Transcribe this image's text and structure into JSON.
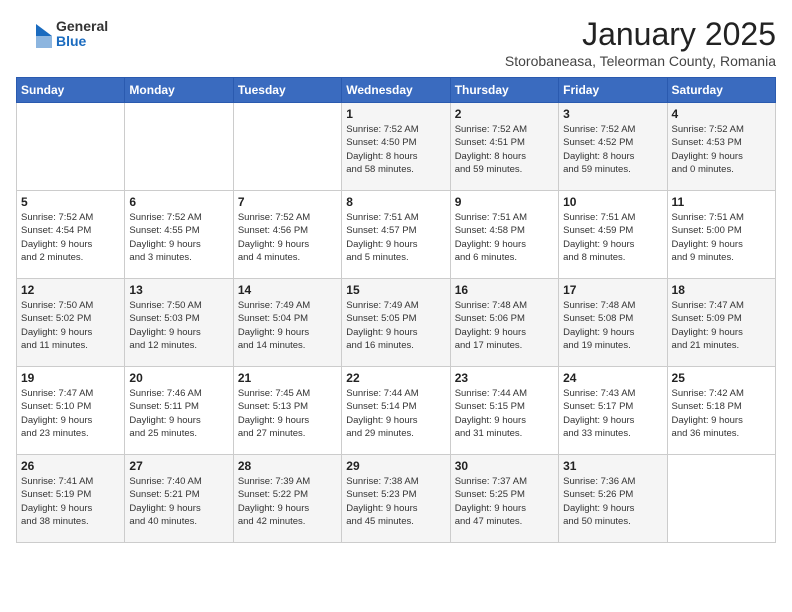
{
  "logo": {
    "general": "General",
    "blue": "Blue"
  },
  "title": "January 2025",
  "location": "Storobaneasa, Teleorman County, Romania",
  "weekdays": [
    "Sunday",
    "Monday",
    "Tuesday",
    "Wednesday",
    "Thursday",
    "Friday",
    "Saturday"
  ],
  "weeks": [
    [
      {
        "day": "",
        "info": ""
      },
      {
        "day": "",
        "info": ""
      },
      {
        "day": "",
        "info": ""
      },
      {
        "day": "1",
        "info": "Sunrise: 7:52 AM\nSunset: 4:50 PM\nDaylight: 8 hours\nand 58 minutes."
      },
      {
        "day": "2",
        "info": "Sunrise: 7:52 AM\nSunset: 4:51 PM\nDaylight: 8 hours\nand 59 minutes."
      },
      {
        "day": "3",
        "info": "Sunrise: 7:52 AM\nSunset: 4:52 PM\nDaylight: 8 hours\nand 59 minutes."
      },
      {
        "day": "4",
        "info": "Sunrise: 7:52 AM\nSunset: 4:53 PM\nDaylight: 9 hours\nand 0 minutes."
      }
    ],
    [
      {
        "day": "5",
        "info": "Sunrise: 7:52 AM\nSunset: 4:54 PM\nDaylight: 9 hours\nand 2 minutes."
      },
      {
        "day": "6",
        "info": "Sunrise: 7:52 AM\nSunset: 4:55 PM\nDaylight: 9 hours\nand 3 minutes."
      },
      {
        "day": "7",
        "info": "Sunrise: 7:52 AM\nSunset: 4:56 PM\nDaylight: 9 hours\nand 4 minutes."
      },
      {
        "day": "8",
        "info": "Sunrise: 7:51 AM\nSunset: 4:57 PM\nDaylight: 9 hours\nand 5 minutes."
      },
      {
        "day": "9",
        "info": "Sunrise: 7:51 AM\nSunset: 4:58 PM\nDaylight: 9 hours\nand 6 minutes."
      },
      {
        "day": "10",
        "info": "Sunrise: 7:51 AM\nSunset: 4:59 PM\nDaylight: 9 hours\nand 8 minutes."
      },
      {
        "day": "11",
        "info": "Sunrise: 7:51 AM\nSunset: 5:00 PM\nDaylight: 9 hours\nand 9 minutes."
      }
    ],
    [
      {
        "day": "12",
        "info": "Sunrise: 7:50 AM\nSunset: 5:02 PM\nDaylight: 9 hours\nand 11 minutes."
      },
      {
        "day": "13",
        "info": "Sunrise: 7:50 AM\nSunset: 5:03 PM\nDaylight: 9 hours\nand 12 minutes."
      },
      {
        "day": "14",
        "info": "Sunrise: 7:49 AM\nSunset: 5:04 PM\nDaylight: 9 hours\nand 14 minutes."
      },
      {
        "day": "15",
        "info": "Sunrise: 7:49 AM\nSunset: 5:05 PM\nDaylight: 9 hours\nand 16 minutes."
      },
      {
        "day": "16",
        "info": "Sunrise: 7:48 AM\nSunset: 5:06 PM\nDaylight: 9 hours\nand 17 minutes."
      },
      {
        "day": "17",
        "info": "Sunrise: 7:48 AM\nSunset: 5:08 PM\nDaylight: 9 hours\nand 19 minutes."
      },
      {
        "day": "18",
        "info": "Sunrise: 7:47 AM\nSunset: 5:09 PM\nDaylight: 9 hours\nand 21 minutes."
      }
    ],
    [
      {
        "day": "19",
        "info": "Sunrise: 7:47 AM\nSunset: 5:10 PM\nDaylight: 9 hours\nand 23 minutes."
      },
      {
        "day": "20",
        "info": "Sunrise: 7:46 AM\nSunset: 5:11 PM\nDaylight: 9 hours\nand 25 minutes."
      },
      {
        "day": "21",
        "info": "Sunrise: 7:45 AM\nSunset: 5:13 PM\nDaylight: 9 hours\nand 27 minutes."
      },
      {
        "day": "22",
        "info": "Sunrise: 7:44 AM\nSunset: 5:14 PM\nDaylight: 9 hours\nand 29 minutes."
      },
      {
        "day": "23",
        "info": "Sunrise: 7:44 AM\nSunset: 5:15 PM\nDaylight: 9 hours\nand 31 minutes."
      },
      {
        "day": "24",
        "info": "Sunrise: 7:43 AM\nSunset: 5:17 PM\nDaylight: 9 hours\nand 33 minutes."
      },
      {
        "day": "25",
        "info": "Sunrise: 7:42 AM\nSunset: 5:18 PM\nDaylight: 9 hours\nand 36 minutes."
      }
    ],
    [
      {
        "day": "26",
        "info": "Sunrise: 7:41 AM\nSunset: 5:19 PM\nDaylight: 9 hours\nand 38 minutes."
      },
      {
        "day": "27",
        "info": "Sunrise: 7:40 AM\nSunset: 5:21 PM\nDaylight: 9 hours\nand 40 minutes."
      },
      {
        "day": "28",
        "info": "Sunrise: 7:39 AM\nSunset: 5:22 PM\nDaylight: 9 hours\nand 42 minutes."
      },
      {
        "day": "29",
        "info": "Sunrise: 7:38 AM\nSunset: 5:23 PM\nDaylight: 9 hours\nand 45 minutes."
      },
      {
        "day": "30",
        "info": "Sunrise: 7:37 AM\nSunset: 5:25 PM\nDaylight: 9 hours\nand 47 minutes."
      },
      {
        "day": "31",
        "info": "Sunrise: 7:36 AM\nSunset: 5:26 PM\nDaylight: 9 hours\nand 50 minutes."
      },
      {
        "day": "",
        "info": ""
      }
    ]
  ]
}
